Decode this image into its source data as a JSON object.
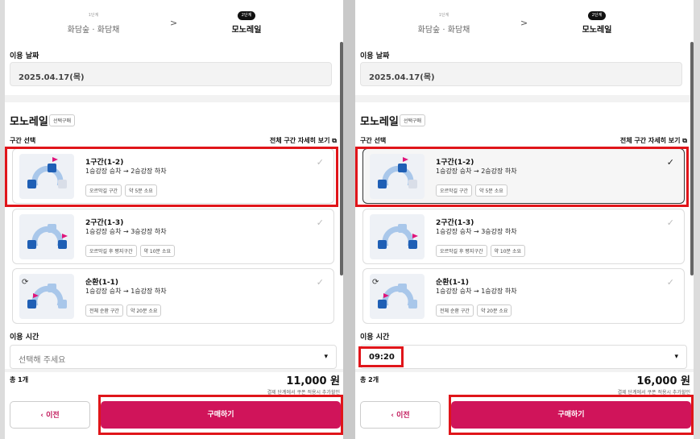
{
  "steps": [
    {
      "num": "1단계",
      "name": "화담숲 · 화담채"
    },
    {
      "num": "2단계",
      "name": "모노레일"
    }
  ],
  "chevron": ">",
  "date": {
    "label": "이용 날짜",
    "value": "2025.04.17(목)"
  },
  "mono": {
    "title": "모노레일",
    "tag": "선택구매",
    "select_label": "구간 선택",
    "view_all": "전체 구간 자세히 보기 ⧉"
  },
  "sections": [
    {
      "title": "1구간(1-2)",
      "desc": "1승강장 승차 → 2승강장 하차",
      "chips": [
        "오르막길 구간",
        "약 5분 소요"
      ]
    },
    {
      "title": "2구간(1-3)",
      "desc": "1승강장 승차 → 3승강장 하차",
      "chips": [
        "오르막길 후 평지구간",
        "약 10분 소요"
      ]
    },
    {
      "title": "순환(1-1)",
      "desc": "1승강장 승차 → 1승강장 하차",
      "chips": [
        "전체 순환 구간",
        "약 20분 소요"
      ]
    }
  ],
  "check_icon": "✓",
  "time": {
    "label": "이용 시간",
    "placeholder": "선택해 주세요",
    "selected": "09:20",
    "caret": "▾"
  },
  "panels": [
    {
      "total": "총 1개",
      "price": "11,000 원"
    },
    {
      "total": "총 2개",
      "price": "16,000 원"
    }
  ],
  "note": "결제 단계에서 쿠폰 적용시 추가할인",
  "btn_prev": "‹  이전",
  "btn_buy": "구매하기",
  "colors": {
    "accent": "#d0145a",
    "highlight": "#e0151a"
  }
}
